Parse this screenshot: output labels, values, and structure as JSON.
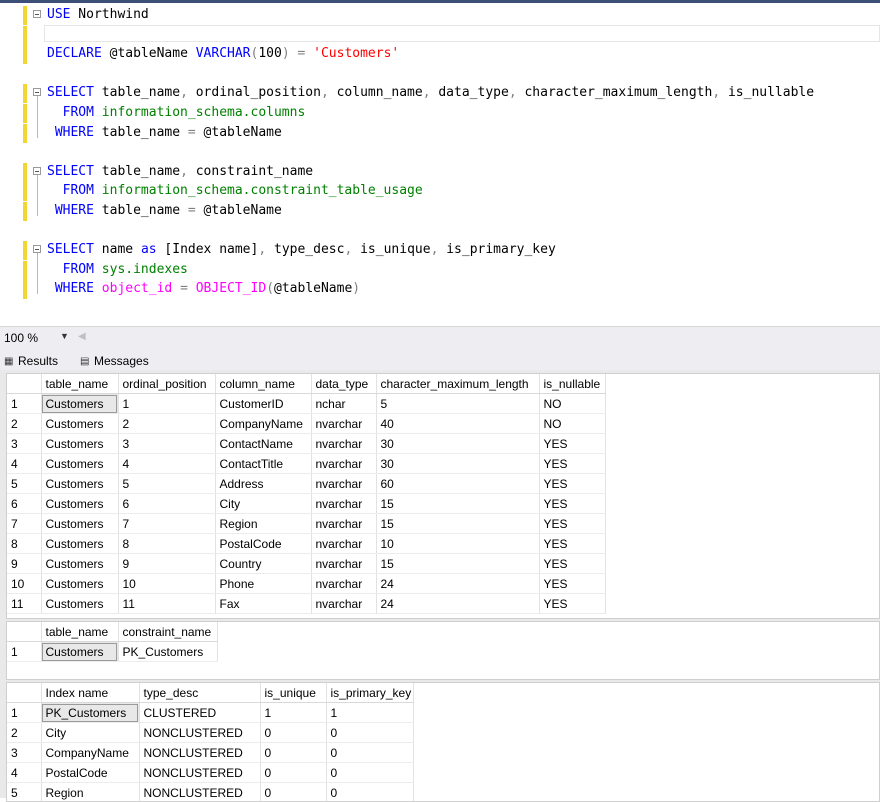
{
  "editor": {
    "lines": [
      {
        "kind": "use",
        "tokens": [
          {
            "t": "USE",
            "c": "kw"
          },
          {
            "t": " Northwind",
            "c": "id"
          }
        ]
      },
      {
        "kind": "blank",
        "tokens": []
      },
      {
        "kind": "declare",
        "tokens": [
          {
            "t": "DECLARE",
            "c": "kw"
          },
          {
            "t": " @tableName ",
            "c": "id"
          },
          {
            "t": "VARCHAR",
            "c": "kw"
          },
          {
            "t": "(",
            "c": "op"
          },
          {
            "t": "100",
            "c": "id"
          },
          {
            "t": ")",
            "c": "op"
          },
          {
            "t": " ",
            "c": "id"
          },
          {
            "t": "=",
            "c": "op"
          },
          {
            "t": " ",
            "c": "id"
          },
          {
            "t": "'Customers'",
            "c": "str"
          }
        ]
      },
      {
        "kind": "blank",
        "tokens": []
      },
      {
        "kind": "q1a",
        "tokens": [
          {
            "t": "SELECT",
            "c": "kw"
          },
          {
            "t": " table_name",
            "c": "id"
          },
          {
            "t": ",",
            "c": "op"
          },
          {
            "t": " ordinal_position",
            "c": "id"
          },
          {
            "t": ",",
            "c": "op"
          },
          {
            "t": " column_name",
            "c": "id"
          },
          {
            "t": ",",
            "c": "op"
          },
          {
            "t": " data_type",
            "c": "id"
          },
          {
            "t": ",",
            "c": "op"
          },
          {
            "t": " character_maximum_length",
            "c": "id"
          },
          {
            "t": ",",
            "c": "op"
          },
          {
            "t": " is_nullable",
            "c": "id"
          }
        ]
      },
      {
        "kind": "q1b",
        "tokens": [
          {
            "t": "  FROM",
            "c": "kw"
          },
          {
            "t": " information_schema.columns",
            "c": "sys"
          }
        ]
      },
      {
        "kind": "q1c",
        "tokens": [
          {
            "t": " WHERE",
            "c": "kw"
          },
          {
            "t": " table_name ",
            "c": "id"
          },
          {
            "t": "=",
            "c": "op"
          },
          {
            "t": " @tableName",
            "c": "id"
          }
        ]
      },
      {
        "kind": "blank",
        "tokens": []
      },
      {
        "kind": "q2a",
        "tokens": [
          {
            "t": "SELECT",
            "c": "kw"
          },
          {
            "t": " table_name",
            "c": "id"
          },
          {
            "t": ",",
            "c": "op"
          },
          {
            "t": " constraint_name",
            "c": "id"
          }
        ]
      },
      {
        "kind": "q2b",
        "tokens": [
          {
            "t": "  FROM",
            "c": "kw"
          },
          {
            "t": " information_schema.constraint_table_usage",
            "c": "sys"
          }
        ]
      },
      {
        "kind": "q2c",
        "tokens": [
          {
            "t": " WHERE",
            "c": "kw"
          },
          {
            "t": " table_name ",
            "c": "id"
          },
          {
            "t": "=",
            "c": "op"
          },
          {
            "t": " @tableName",
            "c": "id"
          }
        ]
      },
      {
        "kind": "blank",
        "tokens": []
      },
      {
        "kind": "q3a",
        "tokens": [
          {
            "t": "SELECT",
            "c": "kw"
          },
          {
            "t": " name ",
            "c": "id"
          },
          {
            "t": "as",
            "c": "kw"
          },
          {
            "t": " [Index name]",
            "c": "id"
          },
          {
            "t": ",",
            "c": "op"
          },
          {
            "t": " type_desc",
            "c": "id"
          },
          {
            "t": ",",
            "c": "op"
          },
          {
            "t": " is_unique",
            "c": "id"
          },
          {
            "t": ",",
            "c": "op"
          },
          {
            "t": " is_primary_key",
            "c": "id"
          }
        ]
      },
      {
        "kind": "q3b",
        "tokens": [
          {
            "t": "  FROM",
            "c": "kw"
          },
          {
            "t": " sys.indexes",
            "c": "sys"
          }
        ]
      },
      {
        "kind": "q3c",
        "tokens": [
          {
            "t": " WHERE",
            "c": "kw"
          },
          {
            "t": " ",
            "c": "id"
          },
          {
            "t": "object_id",
            "c": "fn"
          },
          {
            "t": " ",
            "c": "id"
          },
          {
            "t": "=",
            "c": "op"
          },
          {
            "t": " ",
            "c": "id"
          },
          {
            "t": "OBJECT_ID",
            "c": "fn"
          },
          {
            "t": "(",
            "c": "op"
          },
          {
            "t": "@tableName",
            "c": "id"
          },
          {
            "t": ")",
            "c": "op"
          }
        ]
      }
    ]
  },
  "zoom": {
    "value": "100 %"
  },
  "tabs": {
    "results": "Results",
    "messages": "Messages"
  },
  "grid1": {
    "columns": [
      "table_name",
      "ordinal_position",
      "column_name",
      "data_type",
      "character_maximum_length",
      "is_nullable"
    ],
    "rows": [
      [
        "1",
        "Customers",
        "1",
        "CustomerID",
        "nchar",
        "5",
        "NO"
      ],
      [
        "2",
        "Customers",
        "2",
        "CompanyName",
        "nvarchar",
        "40",
        "NO"
      ],
      [
        "3",
        "Customers",
        "3",
        "ContactName",
        "nvarchar",
        "30",
        "YES"
      ],
      [
        "4",
        "Customers",
        "4",
        "ContactTitle",
        "nvarchar",
        "30",
        "YES"
      ],
      [
        "5",
        "Customers",
        "5",
        "Address",
        "nvarchar",
        "60",
        "YES"
      ],
      [
        "6",
        "Customers",
        "6",
        "City",
        "nvarchar",
        "15",
        "YES"
      ],
      [
        "7",
        "Customers",
        "7",
        "Region",
        "nvarchar",
        "15",
        "YES"
      ],
      [
        "8",
        "Customers",
        "8",
        "PostalCode",
        "nvarchar",
        "10",
        "YES"
      ],
      [
        "9",
        "Customers",
        "9",
        "Country",
        "nvarchar",
        "15",
        "YES"
      ],
      [
        "10",
        "Customers",
        "10",
        "Phone",
        "nvarchar",
        "24",
        "YES"
      ],
      [
        "11",
        "Customers",
        "11",
        "Fax",
        "nvarchar",
        "24",
        "YES"
      ]
    ]
  },
  "grid2": {
    "columns": [
      "table_name",
      "constraint_name"
    ],
    "rows": [
      [
        "1",
        "Customers",
        "PK_Customers"
      ]
    ]
  },
  "grid3": {
    "columns": [
      "Index name",
      "type_desc",
      "is_unique",
      "is_primary_key"
    ],
    "rows": [
      [
        "1",
        "PK_Customers",
        "CLUSTERED",
        "1",
        "1"
      ],
      [
        "2",
        "City",
        "NONCLUSTERED",
        "0",
        "0"
      ],
      [
        "3",
        "CompanyName",
        "NONCLUSTERED",
        "0",
        "0"
      ],
      [
        "4",
        "PostalCode",
        "NONCLUSTERED",
        "0",
        "0"
      ],
      [
        "5",
        "Region",
        "NONCLUSTERED",
        "0",
        "0"
      ]
    ]
  },
  "colors": {
    "keyword": "#0000ff",
    "function": "#ff00ff",
    "string": "#ff0000",
    "system": "#008000",
    "operator": "#808080",
    "change_mark": "#f2d633"
  }
}
